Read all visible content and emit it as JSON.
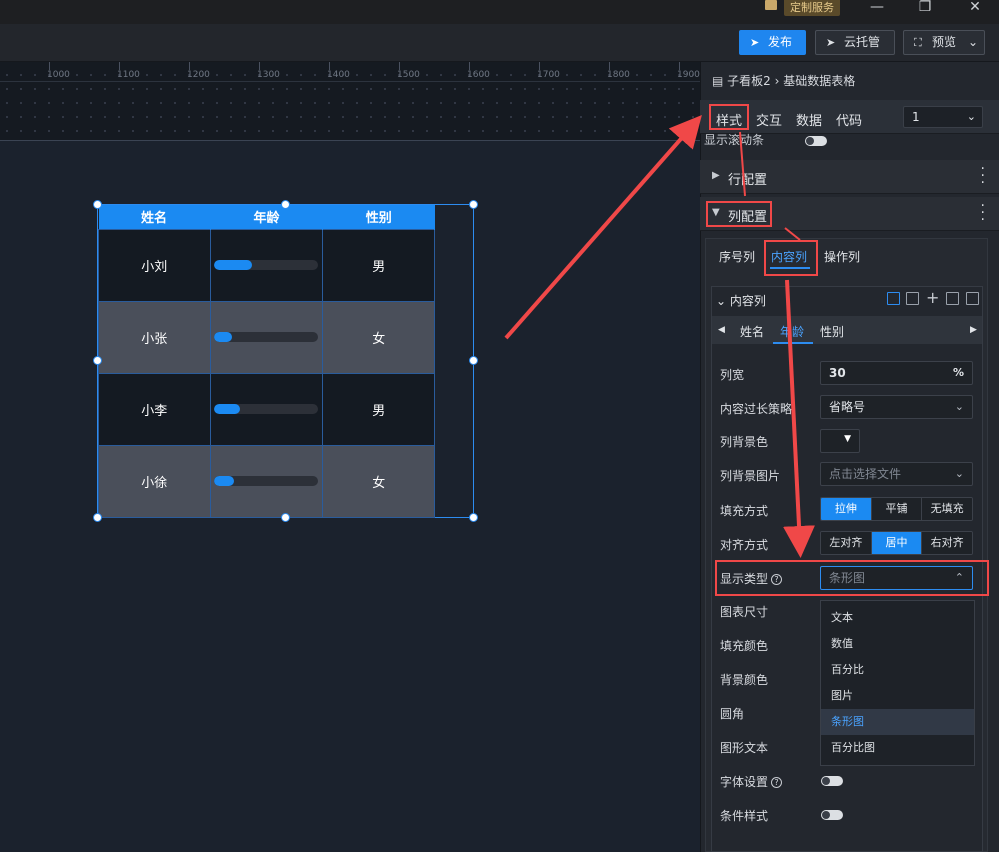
{
  "titlebar": {
    "custom_service": "定制服务"
  },
  "toolbar": {
    "publish": "发布",
    "hosting": "云托管",
    "preview": "预览"
  },
  "ruler": {
    "ticks": [
      "1000",
      "1100",
      "1200",
      "1300",
      "1400",
      "1500",
      "1600",
      "1700",
      "1800",
      "1900"
    ]
  },
  "table": {
    "headers": [
      "姓名",
      "年龄",
      "性别"
    ],
    "rows": [
      {
        "name": "小刘",
        "progress": 0.36,
        "gender": "男"
      },
      {
        "name": "小张",
        "progress": 0.17,
        "gender": "女"
      },
      {
        "name": "小李",
        "progress": 0.25,
        "gender": "男"
      },
      {
        "name": "小徐",
        "progress": 0.19,
        "gender": "女"
      }
    ]
  },
  "panel": {
    "breadcrumb_board": "子看板2",
    "breadcrumb_component": "基础数据表格",
    "tabs": [
      "样式",
      "交互",
      "数据",
      "代码"
    ],
    "page_select": "1",
    "scrollbar_label": "显示滚动条",
    "row_config": "行配置",
    "col_config": "列配置",
    "sub_tabs": [
      "序号列",
      "内容列",
      "操作列"
    ],
    "content_col_title": "内容列",
    "col_tabs": [
      "姓名",
      "年龄",
      "性别"
    ],
    "fields": {
      "col_width_label": "列宽",
      "col_width_value": "30",
      "col_width_unit": "%",
      "overflow_label": "内容过长策略",
      "overflow_value": "省略号",
      "bg_color_label": "列背景色",
      "bg_image_label": "列背景图片",
      "bg_image_placeholder": "点击选择文件",
      "fill_label": "填充方式",
      "fill_options": [
        "拉伸",
        "平铺",
        "无填充"
      ],
      "align_label": "对齐方式",
      "align_options": [
        "左对齐",
        "居中",
        "右对齐"
      ],
      "display_type_label": "显示类型",
      "display_type_value": "条形图",
      "chart_size_label": "图表尺寸",
      "fill_color_label": "填充颜色",
      "bg_color2_label": "背景颜色",
      "radius_label": "圆角",
      "shape_text_label": "图形文本",
      "font_label": "字体设置",
      "cond_style_label": "条件样式"
    },
    "dropdown": [
      "文本",
      "数值",
      "百分比",
      "图片",
      "条形图",
      "百分比图"
    ]
  }
}
